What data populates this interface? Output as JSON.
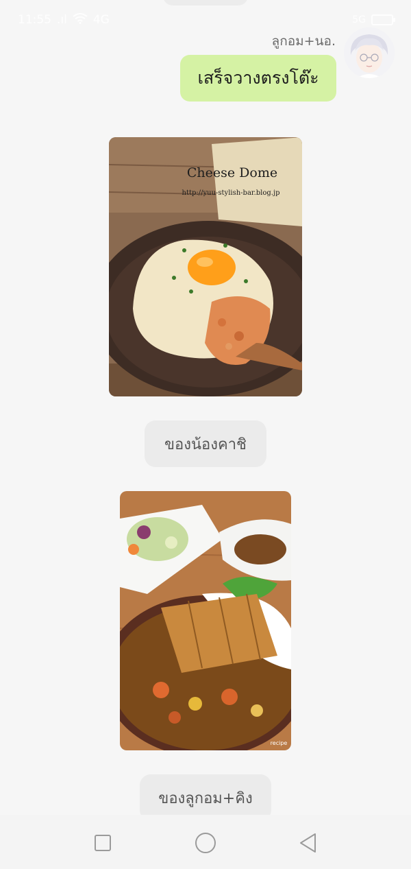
{
  "status_bar": {
    "time": "11:55",
    "network": ".ıl",
    "data": "4G",
    "sim": "5G",
    "battery": "53"
  },
  "chat": {
    "sender_name": "ลูกอม+นอ.",
    "message_text": "เสร็จวางตรงโต๊ะ",
    "photo1": {
      "overlay_title": "Cheese Dome",
      "overlay_url": "http://yuu-stylish-bar.blog.jp"
    },
    "caption1": "ของน้องคาชิ",
    "photo2": {
      "watermark": "recipe"
    },
    "caption2": "ของลูกอม+คิง"
  },
  "colors": {
    "background": "#f6f6f6",
    "bubble": "#d5f2a4",
    "pill": "#ebebeb"
  },
  "nav": {
    "recent_icon": "square-icon",
    "home_icon": "circle-icon",
    "back_icon": "triangle-back-icon"
  }
}
